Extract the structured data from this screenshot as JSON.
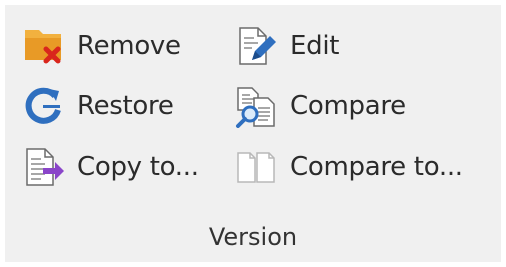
{
  "group": {
    "label": "Version",
    "commands": {
      "remove": {
        "label": "Remove",
        "icon": "remove-version-icon"
      },
      "restore": {
        "label": "Restore",
        "icon": "restore-icon"
      },
      "copy_to": {
        "label": "Copy to...",
        "icon": "copy-to-icon"
      },
      "edit": {
        "label": "Edit",
        "icon": "edit-icon"
      },
      "compare": {
        "label": "Compare",
        "icon": "compare-icon"
      },
      "compare_to": {
        "label": "Compare to...",
        "icon": "compare-to-icon",
        "enabled": false
      }
    }
  },
  "colors": {
    "background": "#f0f0f0",
    "accent_blue": "#2f6fbf",
    "remove_red": "#d9261c",
    "folder_orange": "#f0a830",
    "copy_purple": "#8a45c9"
  }
}
